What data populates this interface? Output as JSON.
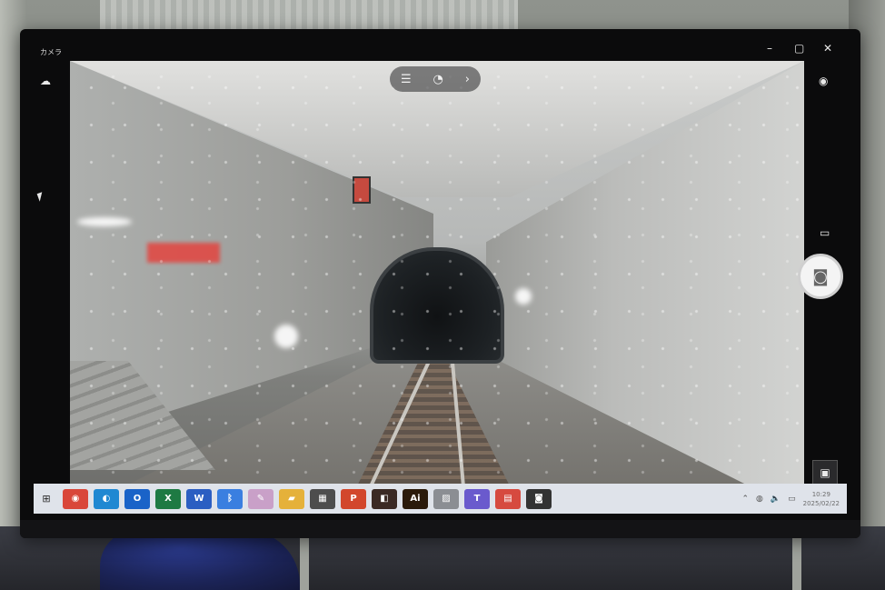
{
  "app": {
    "title": "カメラ"
  },
  "window": {
    "minimize": "–",
    "maximize": "▢",
    "close": "✕"
  },
  "camera": {
    "toolbar": {
      "settings_glyph": "☰",
      "timer_glyph": "◔",
      "more_glyph": "›"
    },
    "rail": {
      "top_glyph": "◉",
      "video_glyph": "▭",
      "photo_glyph": "◙",
      "gallery_glyph": "▣"
    }
  },
  "taskbar": {
    "start_glyph": "⊞",
    "icons": [
      {
        "name": "chrome-icon",
        "glyph": "◉",
        "color": "#d9473a"
      },
      {
        "name": "edge-icon",
        "glyph": "◐",
        "color": "#1f88d2"
      },
      {
        "name": "outlook-icon",
        "glyph": "O",
        "color": "#1a63c8"
      },
      {
        "name": "excel-icon",
        "glyph": "X",
        "color": "#1e7a43"
      },
      {
        "name": "word-icon",
        "glyph": "W",
        "color": "#2b5ec2"
      },
      {
        "name": "bluetooth-icon",
        "glyph": "ᛒ",
        "color": "#3a7fe0"
      },
      {
        "name": "paint-icon",
        "glyph": "✎",
        "color": "#c9a0c8"
      },
      {
        "name": "folder-icon",
        "glyph": "▰",
        "color": "#e5b13a"
      },
      {
        "name": "calculator-icon",
        "glyph": "▦",
        "color": "#4d4d4d"
      },
      {
        "name": "powerpoint-icon",
        "glyph": "P",
        "color": "#d2472c"
      },
      {
        "name": "app-orange-icon",
        "glyph": "◧",
        "color": "#3b2a24"
      },
      {
        "name": "illustrator-icon",
        "glyph": "Ai",
        "color": "#2b1a0a"
      },
      {
        "name": "image-viewer-icon",
        "glyph": "▨",
        "color": "#8b8e93"
      },
      {
        "name": "teams-icon",
        "glyph": "T",
        "color": "#6a5acd"
      },
      {
        "name": "store-icon",
        "glyph": "▤",
        "color": "#d64a3f"
      },
      {
        "name": "camera-icon",
        "glyph": "◙",
        "color": "#333333"
      }
    ],
    "tray": {
      "chevron": "⌃",
      "network": "◍",
      "volume": "🔈",
      "battery": "▭",
      "time": "10:29",
      "date": "2025/02/22"
    }
  }
}
